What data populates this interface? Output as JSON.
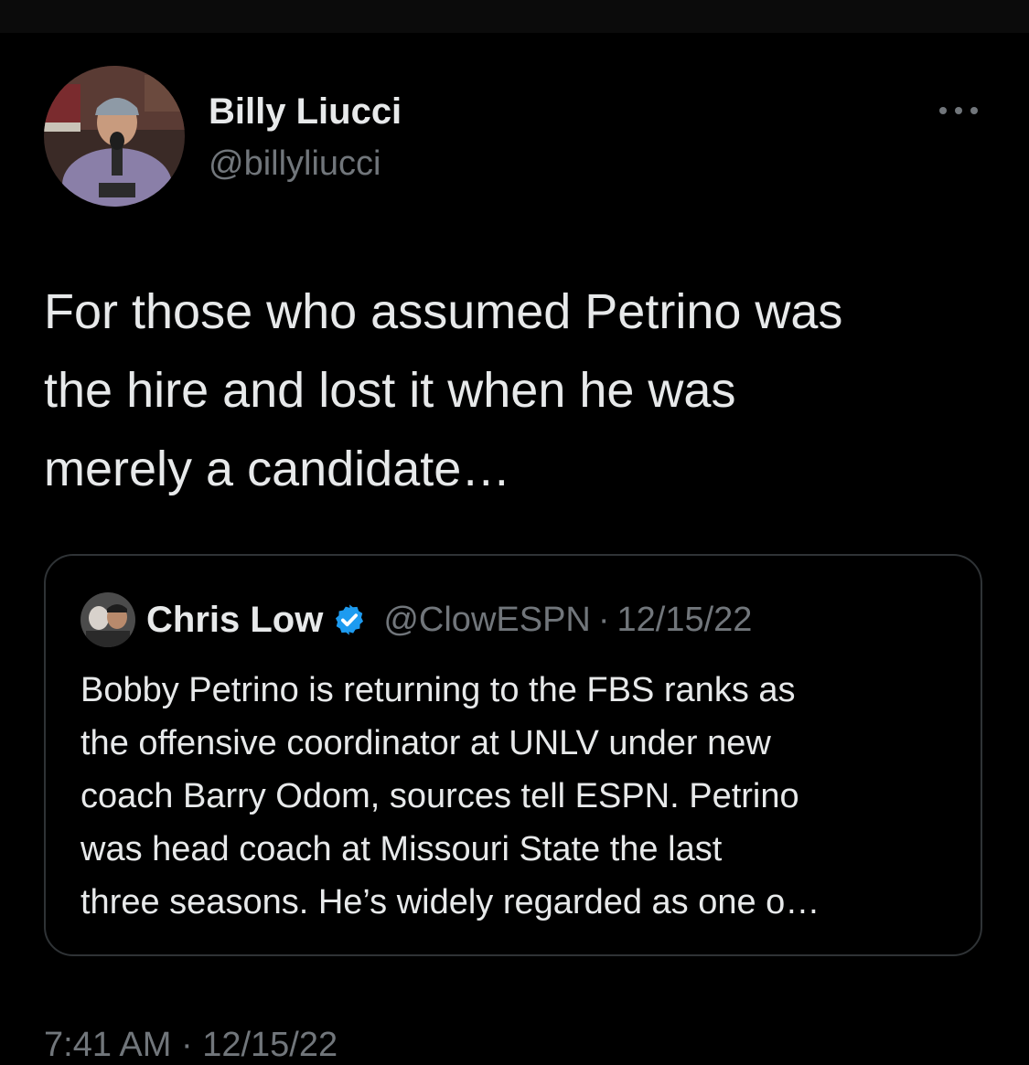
{
  "tweet": {
    "author_name": "Billy Liucci",
    "author_handle": "@billyliucci",
    "avatar_icon": "profile-photo-icon",
    "more_icon": "more-horizontal-icon",
    "text": "For those who assumed Petrino was\nthe hire and lost it when he was\nmerely a candidate…",
    "timestamp_partial": "7:41 AM · 12/15/22"
  },
  "quote": {
    "author_name": "Chris Low",
    "verified_icon": "verified-badge-icon",
    "author_handle": "@ClowESPN",
    "separator": "·",
    "date": "12/15/22",
    "text": "Bobby Petrino is returning to the FBS ranks as\nthe offensive coordinator at UNLV under new\ncoach Barry Odom, sources tell ESPN. Petrino\nwas head coach at Missouri State the last\nthree seasons. He’s widely regarded as one o…"
  },
  "colors": {
    "background": "#000000",
    "text_primary": "#e7e9ea",
    "text_secondary": "#71767b",
    "border": "#2f3336",
    "verified_blue": "#1d9bf0"
  }
}
